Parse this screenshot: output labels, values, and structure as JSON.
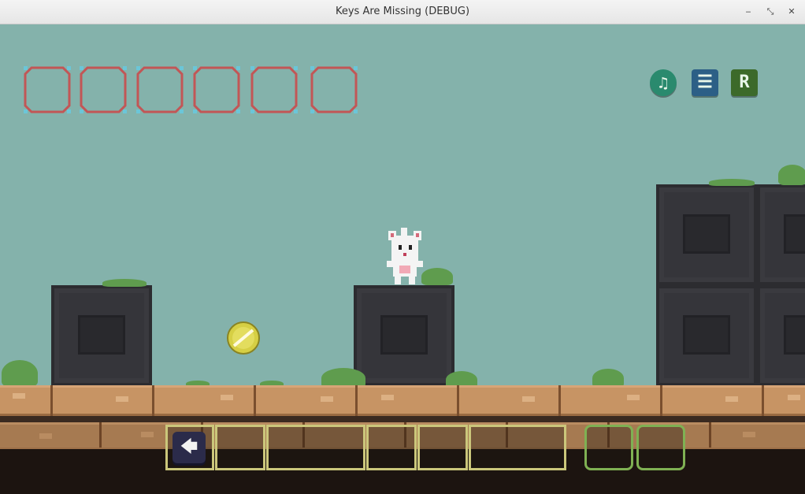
{
  "window": {
    "title": "Keys Are Missing (DEBUG)",
    "minimize_glyph": "‒",
    "restore_glyph": "⤡",
    "close_glyph": "✕"
  },
  "hud": {
    "key_slots": [
      "",
      "",
      "",
      "",
      "",
      ""
    ],
    "music_button": {
      "icon": "music-note-icon",
      "glyph": "♫",
      "color": "#2a8a6e"
    },
    "menu_button": {
      "icon": "hamburger-menu-icon",
      "glyph": "☰",
      "color": "#2c5f86"
    },
    "restart_button": {
      "icon": "restart-icon",
      "glyph": "R",
      "color": "#3c6a2a"
    }
  },
  "toolbar": {
    "back_button": {
      "icon": "back-arrow-icon",
      "glyph": "🡄"
    },
    "empty_slot_count": 5,
    "green_slot_count": 2
  },
  "colors": {
    "sky": "#84b2ab",
    "key_slot_border": "#c25656",
    "key_slot_corner": "#6bc6d8",
    "tray_border": "#cbc77b",
    "tray_border_green": "#7fb153",
    "orb": "#d6cf44"
  }
}
